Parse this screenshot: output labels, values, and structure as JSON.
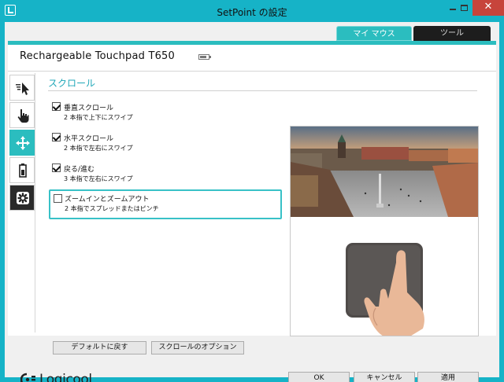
{
  "window": {
    "title": "SetPoint の設定",
    "minimize_glyph": "",
    "close_glyph": "✕"
  },
  "tabs": [
    {
      "label": "マイ マウス",
      "active": true
    },
    {
      "label": "ツール",
      "active": false
    }
  ],
  "device": {
    "name": "Rechargeable Touchpad T650",
    "battery_icon": "battery-icon"
  },
  "sidebar": {
    "items": [
      {
        "icon": "pointer-icon",
        "active": false
      },
      {
        "icon": "hand-tap-icon",
        "active": false
      },
      {
        "icon": "move-arrows-icon",
        "active": true
      },
      {
        "icon": "battery-status-icon",
        "active": false
      },
      {
        "icon": "settings-gear-icon",
        "active": false
      }
    ]
  },
  "section": {
    "title": "スクロール"
  },
  "options": [
    {
      "label": "垂直スクロール",
      "description": "2 本指で上下にスワイプ",
      "checked": true
    },
    {
      "label": "水平スクロール",
      "description": "2 本指で左右にスワイプ",
      "checked": true
    },
    {
      "label": "戻る/進む",
      "description": "3 本指で左右にスワイプ",
      "checked": true
    },
    {
      "label": "ズームインとズームアウト",
      "description": "2 本指でスプレッドまたはピンチ",
      "checked": false
    }
  ],
  "buttons": {
    "default": "デフォルトに戻す",
    "scroll_options": "スクロールのオプション",
    "ok": "OK",
    "cancel": "キャンセル",
    "apply": "適用"
  },
  "brand": {
    "name": "Logicool"
  },
  "colors": {
    "accent": "#16b3c7",
    "tab_active": "#2bbdbf",
    "close": "#c7443b"
  }
}
